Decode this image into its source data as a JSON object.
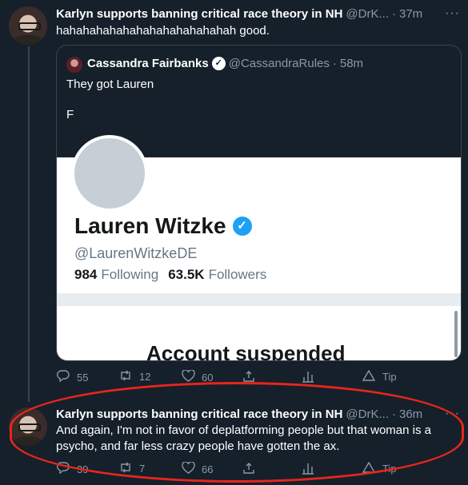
{
  "colors": {
    "background": "#15202b",
    "secondary_text": "#8899a6",
    "verified_blue": "#1da1f2",
    "annotation_red": "#e8251b"
  },
  "tweet1": {
    "name": "Karlyn supports banning critical race theory in NH",
    "handle": "@DrK...",
    "sep": "·",
    "time": "37m",
    "more": "···",
    "text": "hahahahahahahahahahahahahah good.",
    "quote": {
      "name": "Cassandra Fairbanks",
      "verified": "✓",
      "handle": "@CassandraRules",
      "sep": "·",
      "time": "58m",
      "text_line1": "They got Lauren",
      "text_line2": "F",
      "profile": {
        "name": "Lauren Witzke",
        "verified": "✓",
        "handle": "@LaurenWitzkeDE",
        "following_count": "984",
        "following_label": "Following",
        "followers_count": "63.5K",
        "followers_label": "Followers",
        "suspended_label": "Account suspended"
      }
    },
    "actions": {
      "reply_icon": "speech-bubble-icon",
      "reply_count": "55",
      "retweet_icon": "retweet-icon",
      "retweet_count": "12",
      "like_icon": "heart-icon",
      "like_count": "60",
      "share_icon": "share-icon",
      "analytics_icon": "bar-chart-icon",
      "tip_label": "Tip"
    }
  },
  "tweet2": {
    "name": "Karlyn supports banning critical race theory in NH",
    "handle": "@DrK...",
    "sep": "·",
    "time": "36m",
    "more": "···",
    "text": "And again, I'm not in favor of deplatforming people but that woman is a psycho, and far less crazy people have gotten the ax.",
    "actions": {
      "reply_count": "39",
      "retweet_count": "7",
      "like_count": "66",
      "tip_label": "Tip"
    }
  }
}
